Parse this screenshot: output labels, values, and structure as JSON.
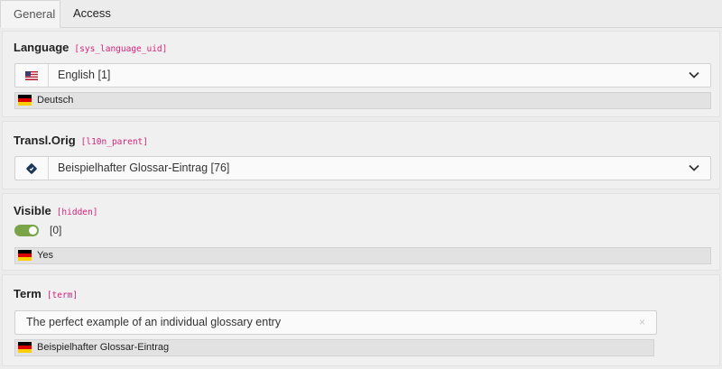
{
  "tabs": [
    {
      "label": "General",
      "active": true
    },
    {
      "label": "Access",
      "active": false
    }
  ],
  "language": {
    "label": "Language",
    "field": "[sys_language_uid]",
    "value": "English [1]",
    "flag_icon": "us-flag-icon",
    "reference": {
      "flag_icon": "de-flag-icon",
      "text": "Deutsch"
    }
  },
  "transl_orig": {
    "label": "Transl.Orig",
    "field": "[l10n_parent]",
    "value": "Beispielhafter Glossar-Eintrag [76]",
    "record_icon": "record-icon"
  },
  "visible": {
    "label": "Visible",
    "field": "[hidden]",
    "toggle_on": true,
    "value": "[0]",
    "reference": {
      "flag_icon": "de-flag-icon",
      "text": "Yes"
    }
  },
  "term": {
    "label": "Term",
    "field": "[term]",
    "value": "The perfect example of an individual glossary entry",
    "clear_symbol": "×",
    "reference": {
      "flag_icon": "de-flag-icon",
      "text": "Beispielhafter Glossar-Eintrag"
    }
  },
  "colors": {
    "accent_field": "#d4237a",
    "toggle_on": "#79a548"
  }
}
